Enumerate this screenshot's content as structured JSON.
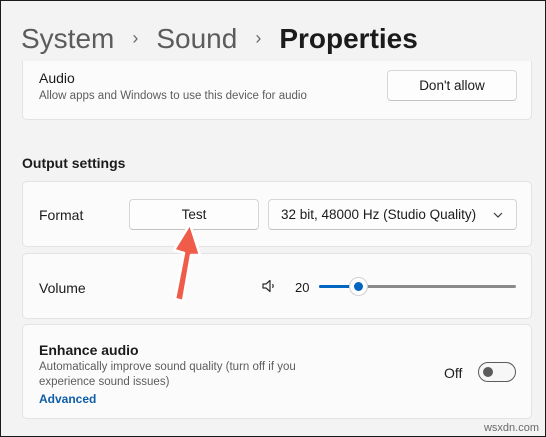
{
  "breadcrumb": {
    "items": [
      "System",
      "Sound",
      "Properties"
    ]
  },
  "audio": {
    "title": "Audio",
    "description": "Allow apps and Windows to use this device for audio",
    "button_label": "Don't allow"
  },
  "output_settings": {
    "title": "Output settings",
    "format": {
      "label": "Format",
      "test_button": "Test",
      "selected_format": "32 bit, 48000 Hz (Studio Quality)"
    },
    "volume": {
      "label": "Volume",
      "value": "20",
      "level_fraction": 0.2
    },
    "enhance": {
      "title": "Enhance audio",
      "description_line1": "Automatically improve sound quality (turn off if you",
      "description_line2": "experience sound issues)",
      "link": "Advanced",
      "toggle_state": "Off",
      "enabled": false
    }
  },
  "annotation": {
    "arrow_color": "#f05c4a"
  },
  "watermark": "wsxdn.com",
  "colors": {
    "accent": "#0067c0",
    "link": "#0f5ea8"
  }
}
